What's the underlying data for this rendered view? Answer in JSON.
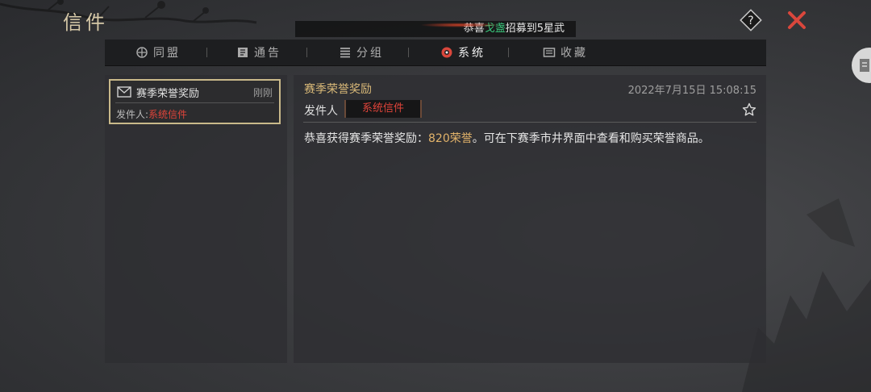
{
  "header": {
    "title": "信件",
    "marquee": {
      "prefix": "恭喜",
      "highlight": "戈盏",
      "suffix": "招募到5星武"
    },
    "help_icon": "question-diamond-icon",
    "close_icon": "close-x-icon"
  },
  "tabs": [
    {
      "label": "同盟",
      "icon": "alliance-icon"
    },
    {
      "label": "通告",
      "icon": "notice-icon"
    },
    {
      "label": "分组",
      "icon": "group-icon"
    },
    {
      "label": "系统",
      "icon": "system-gear-icon",
      "active": true
    },
    {
      "label": "收藏",
      "icon": "favorites-box-icon"
    }
  ],
  "mail_list": [
    {
      "subject": "赛季荣誉奖励",
      "time": "刚刚",
      "sender_label": "发件人:",
      "sender": "系统信件",
      "icon": "envelope-icon"
    }
  ],
  "detail": {
    "subject": "赛季荣誉奖励",
    "date": "2022年7月15日 15:08:15",
    "from_label": "发件人",
    "from_value": "系统信件",
    "body_prefix": "恭喜获得赛季荣誉奖励：",
    "body_highlight": "820荣誉",
    "body_suffix": "。可在下赛季市井界面中查看和购买荣誉商品。",
    "favorite_icon": "star-outline-icon"
  },
  "colors": {
    "accent_gold": "#d9b978",
    "sender_red": "#e0443a",
    "highlight_green": "#39c47a",
    "close_red": "#d9473c"
  }
}
